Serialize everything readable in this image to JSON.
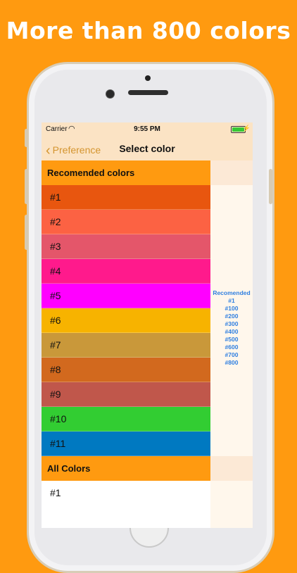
{
  "headline": "More than 800 colors",
  "status_bar": {
    "carrier": "Carrier",
    "time": "9:55 PM"
  },
  "nav": {
    "back_label": "Preference",
    "title": "Select color"
  },
  "sections": [
    {
      "header": "Recomended colors"
    },
    {
      "header": "All Colors"
    }
  ],
  "recommended_rows": [
    {
      "label": "#1",
      "color": "#e8560f"
    },
    {
      "label": "#2",
      "color": "#fc6243"
    },
    {
      "label": "#3",
      "color": "#e4566a"
    },
    {
      "label": "#4",
      "color": "#ff1a8c"
    },
    {
      "label": "#5",
      "color": "#ff00ff"
    },
    {
      "label": "#6",
      "color": "#f7b300"
    },
    {
      "label": "#7",
      "color": "#c9983a"
    },
    {
      "label": "#8",
      "color": "#d2691e"
    },
    {
      "label": "#9",
      "color": "#c0574b"
    },
    {
      "label": "#10",
      "color": "#32cd32"
    },
    {
      "label": "#11",
      "color": "#0079c1"
    }
  ],
  "all_rows": [
    {
      "label": "#1"
    }
  ],
  "index_titles": [
    "Recomended",
    "#1",
    "#100",
    "#200",
    "#300",
    "#400",
    "#500",
    "#600",
    "#700",
    "#800"
  ],
  "colors": {
    "background": "#ff9a10",
    "nav_bar": "#fbe3c4",
    "back_tint": "#d4952f",
    "index_text": "#2f7fe0"
  }
}
